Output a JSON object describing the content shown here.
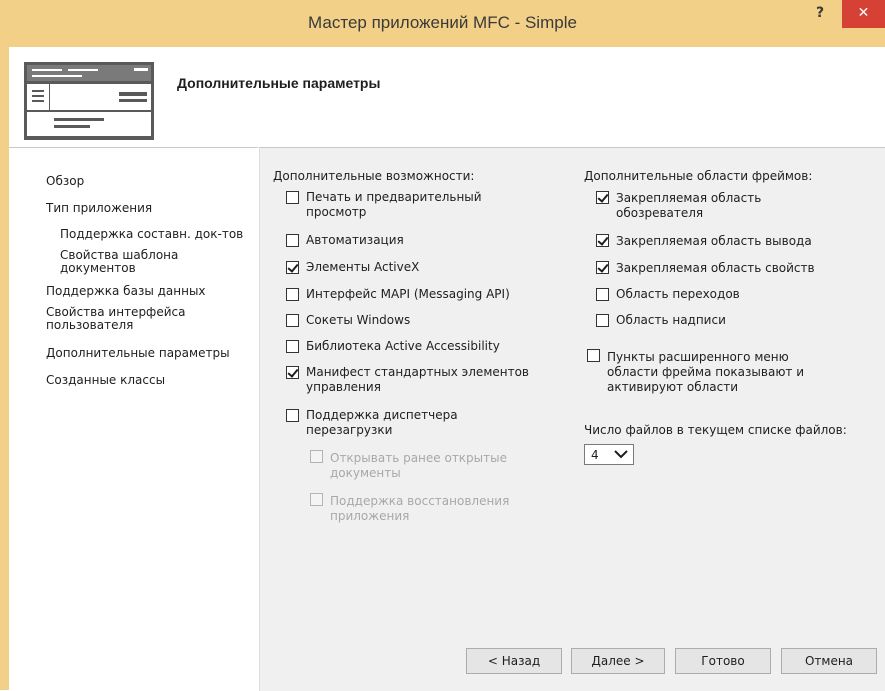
{
  "window": {
    "title": "Мастер приложений MFC - Simple",
    "help": "?",
    "close": "✕"
  },
  "header": {
    "title": "Дополнительные параметры"
  },
  "sidebar": {
    "items": [
      {
        "label": "Обзор"
      },
      {
        "label": "Тип приложения"
      },
      {
        "label": "Поддержка составн. док-тов"
      },
      {
        "label": "Свойства шаблона"
      },
      {
        "label": "документов"
      },
      {
        "label": "Поддержка базы данных"
      },
      {
        "label": "Свойства интерфейса"
      },
      {
        "label": "пользователя"
      },
      {
        "label": "Дополнительные параметры"
      },
      {
        "label": "Созданные классы"
      }
    ]
  },
  "features": {
    "label": "Дополнительные возможности:",
    "items": [
      {
        "line1": "Печать и предварительный",
        "line2": "просмотр",
        "checked": false
      },
      {
        "line1": "Автоматизация",
        "checked": false
      },
      {
        "line1": "Элементы ActiveX",
        "checked": true
      },
      {
        "line1": "Интерфейс MAPI (Messaging API)",
        "checked": false
      },
      {
        "line1": "Сокеты Windows",
        "checked": false
      },
      {
        "line1": "Библиотека Active Accessibility",
        "checked": false
      },
      {
        "line1": "Манифест стандартных элементов",
        "line2": "управления",
        "checked": true
      },
      {
        "line1": "Поддержка диспетчера",
        "line2": "перезагрузки",
        "checked": false
      },
      {
        "line1": "Открывать ранее открытые",
        "line2": "документы",
        "checked": false,
        "disabled": true
      },
      {
        "line1": "Поддержка восстановления",
        "line2": "приложения",
        "checked": false,
        "disabled": true
      }
    ]
  },
  "frames": {
    "label": "Дополнительные области фреймов:",
    "items": [
      {
        "line1": "Закрепляемая область",
        "line2": "обозревателя",
        "checked": true
      },
      {
        "line1": "Закрепляемая область вывода",
        "checked": true
      },
      {
        "line1": "Закрепляемая область свойств",
        "checked": true
      },
      {
        "line1": "Область переходов",
        "checked": false
      },
      {
        "line1": "Область надписи",
        "checked": false
      }
    ],
    "menu_option": {
      "line1": "Пункты расширенного меню",
      "line2": "области фрейма показывают и",
      "line3": "активируют области",
      "checked": false
    },
    "files_label": "Число файлов в текущем списке файлов:",
    "files_value": "4"
  },
  "buttons": {
    "back": "< Назад",
    "next": "Далее >",
    "finish": "Готово",
    "cancel": "Отмена"
  }
}
